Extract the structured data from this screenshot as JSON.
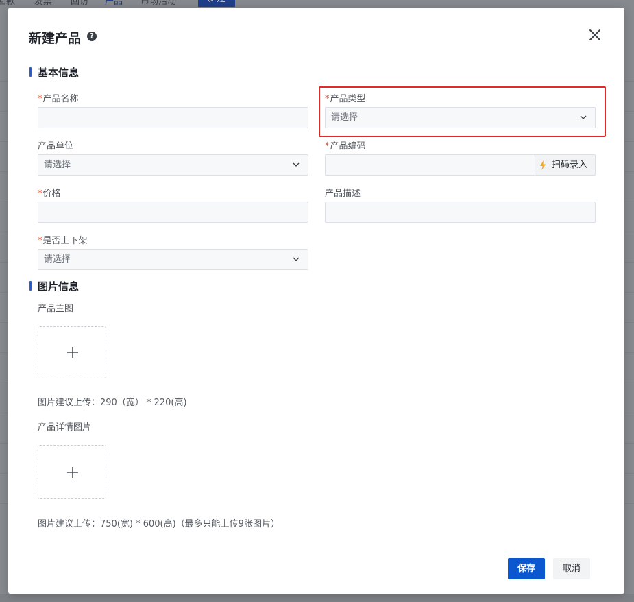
{
  "background": {
    "nav_items": [
      "回款",
      "发票",
      "回访",
      "产品",
      "市场活动"
    ],
    "new_button": "新建"
  },
  "modal": {
    "title": "新建产品",
    "help_icon": "question-circle-icon",
    "close_icon": "close-icon"
  },
  "sections": {
    "basic": "基本信息",
    "images": "图片信息"
  },
  "fields": {
    "product_name": {
      "label": "产品名称",
      "required": "*",
      "value": ""
    },
    "product_type": {
      "label": "产品类型",
      "required": "*",
      "placeholder": "请选择"
    },
    "product_unit": {
      "label": "产品单位",
      "placeholder": "请选择"
    },
    "product_code": {
      "label": "产品编码",
      "required": "*",
      "value": "",
      "scan_label": "扫码录入"
    },
    "price": {
      "label": "价格",
      "required": "*",
      "value": ""
    },
    "description": {
      "label": "产品描述",
      "value": ""
    },
    "on_shelf": {
      "label": "是否上下架",
      "required": "*",
      "placeholder": "请选择"
    }
  },
  "images": {
    "main_label": "产品主图",
    "main_hint": "图片建议上传：290（宽） * 220(高)",
    "detail_label": "产品详情图片",
    "detail_hint": "图片建议上传：750(宽) * 600(高)（最多只能上传9张图片）"
  },
  "buttons": {
    "save": "保存",
    "cancel": "取消"
  },
  "colors": {
    "primary": "#0b57d0",
    "required": "#e6492d",
    "highlight": "#e02a2a",
    "section_bar": "#2a5bd7"
  }
}
